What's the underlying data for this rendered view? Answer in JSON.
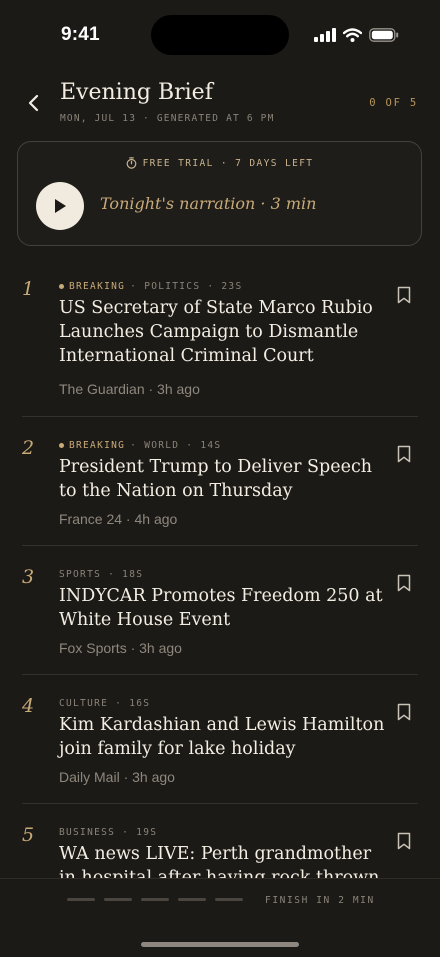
{
  "status_bar": {
    "time": "9:41"
  },
  "header": {
    "title": "Evening Brief",
    "subtitle": "MON, JUL 13 · GENERATED AT 6 PM",
    "progress": "0 OF 5"
  },
  "narration": {
    "trial": "FREE TRIAL · 7 DAYS LEFT",
    "label": "Tonight's narration · 3 min"
  },
  "stories": [
    {
      "number": "1",
      "breaking": "BREAKING",
      "category": "· POLITICS · 23S",
      "headline": "US Secretary of State Marco Rubio Launches Campaign to Dismantle International Criminal Court",
      "source": "The Guardian · 3h ago"
    },
    {
      "number": "2",
      "breaking": "BREAKING",
      "category": "· WORLD · 14S",
      "headline": "President Trump to Deliver Speech to the Nation on Thursday",
      "source": "France 24 · 4h ago"
    },
    {
      "number": "3",
      "breaking": "",
      "category": "SPORTS · 18S",
      "headline": "INDYCAR Promotes Freedom 250 at White House Event",
      "source": "Fox Sports · 3h ago"
    },
    {
      "number": "4",
      "breaking": "",
      "category": "CULTURE · 16S",
      "headline": "Kim Kardashian and Lewis Hamilton join family for lake holiday",
      "source": "Daily Mail · 3h ago"
    },
    {
      "number": "5",
      "breaking": "",
      "category": "BUSINESS · 19S",
      "headline": "WA news LIVE: Perth grandmother in hospital after having rock thrown",
      "source": ""
    }
  ],
  "footer": {
    "finish": "FINISH IN 2 MIN",
    "segments": 5,
    "completed": 0
  },
  "colors": {
    "background": "#1c1a17",
    "accent": "#c8aa78",
    "text": "#f3ede2",
    "muted": "#8a8378"
  }
}
